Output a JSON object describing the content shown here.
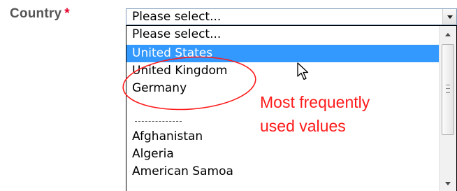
{
  "form": {
    "label": "Country",
    "required_mark": "*",
    "selected_value": "Please select..."
  },
  "dropdown": {
    "options": [
      "Please select...",
      "United States",
      "United Kingdom",
      "Germany",
      "-----------",
      "Afghanistan",
      "Algeria",
      "American Samoa"
    ],
    "highlighted_option": "United States"
  },
  "annotation": {
    "line1": "Most frequently",
    "line2": "used values",
    "color": "#ff1a1a"
  },
  "colors": {
    "label_text": "#555555",
    "required_mark": "#e4002b",
    "highlight": "#3399ff"
  },
  "icons": {
    "select_arrow": "chevron-down-icon",
    "scroll_up": "scroll-up-arrow-icon",
    "scroll_down": "scroll-down-arrow-icon",
    "cursor": "mouse-pointer-icon",
    "annotation_mark": "red-ellipse-annotation"
  }
}
